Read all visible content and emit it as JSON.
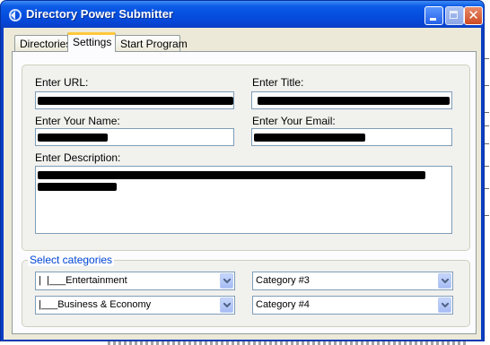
{
  "window": {
    "title": "Directory Power Submitter",
    "close_glyph": "✕"
  },
  "tabs": [
    {
      "label": "Directories",
      "active": false
    },
    {
      "label": "Settings",
      "active": true
    },
    {
      "label": "Start Program",
      "active": false
    }
  ],
  "form": {
    "url_label": "Enter URL:",
    "title_label": "Enter Title:",
    "name_label": "Enter Your Name:",
    "email_label": "Enter Your Email:",
    "description_label": "Enter Description:"
  },
  "categories": {
    "legend": "Select categories",
    "cat1": "|  |___Entertainment",
    "cat2": "|___Business & Economy",
    "cat3": "Category #3",
    "cat4": "Category #4"
  },
  "colors": {
    "accent": "#0046d5",
    "titlebar": "#0550e0",
    "tab_highlight": "#ffc83c"
  }
}
